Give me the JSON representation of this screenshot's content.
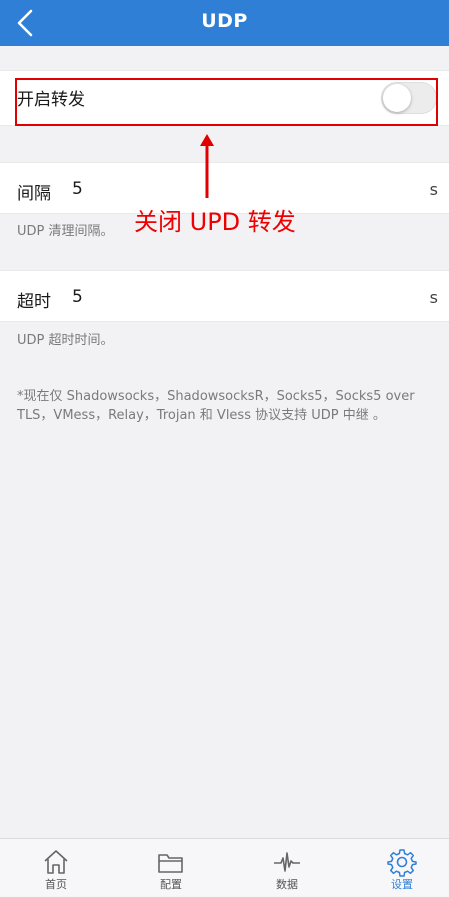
{
  "header": {
    "title": "UDP"
  },
  "forward_row": {
    "label": "开启转发",
    "enabled": false
  },
  "interval_row": {
    "label": "间隔",
    "value": "5",
    "unit": "s",
    "hint": "UDP 清理间隔。"
  },
  "timeout_row": {
    "label": "超时",
    "value": "5",
    "unit": "s",
    "hint": "UDP 超时时间。"
  },
  "note": "*现在仅 Shadowsocks，ShadowsocksR，Socks5，Socks5 over TLS，VMess，Relay，Trojan 和 Vless 协议支持 UDP 中继 。",
  "annotation": {
    "text": "关闭 UPD 转发",
    "color": "#ee0000"
  },
  "tabbar": {
    "tabs": [
      {
        "label": "首页",
        "icon": "home-icon"
      },
      {
        "label": "配置",
        "icon": "folder-icon"
      },
      {
        "label": "数据",
        "icon": "pulse-icon"
      },
      {
        "label": "设置",
        "icon": "gear-icon",
        "active": true
      }
    ]
  },
  "colors": {
    "accent": "#2f7fd6",
    "background": "#f2f2f5"
  }
}
